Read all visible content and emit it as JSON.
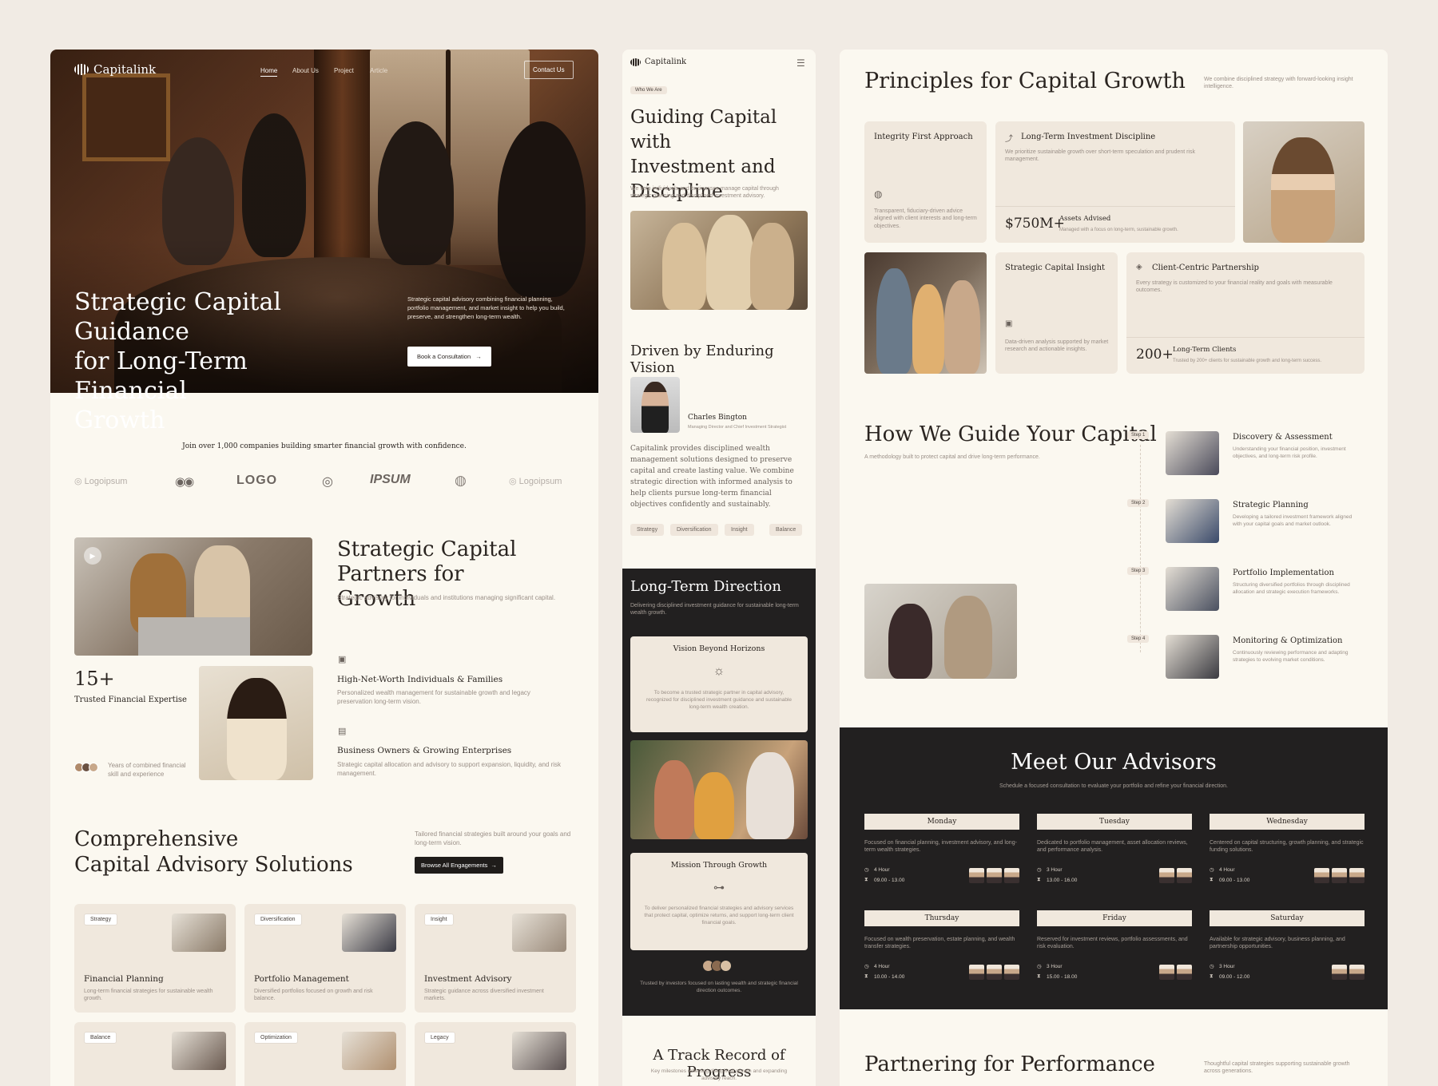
{
  "card1": {
    "nav": {
      "brand": "Capitalink",
      "links": [
        "Home",
        "About Us",
        "Project",
        "Article"
      ],
      "cta": "Contact Us"
    },
    "hero": {
      "title_l1": "Strategic Capital Guidance",
      "title_l2": "for Long-Term Financial",
      "title_l3": "Growth",
      "desc": "Strategic capital advisory combining financial planning, portfolio management, and market insight to help you build, preserve, and strengthen long-term wealth.",
      "button": "Book a Consultation"
    },
    "logos": {
      "intro": "Join over 1,000 companies building smarter financial growth with confidence.",
      "items": [
        "Logoipsum",
        "LOGO",
        "IPSUM",
        "Logoipsum"
      ]
    },
    "partners": {
      "title_l1": "Strategic Capital Partners for",
      "title_l2": "Growth",
      "subtitle": "Strategic advisory for individuals and institutions managing significant capital.",
      "stat_value": "15+",
      "stat_label": "Trusted Financial Expertise",
      "stat_note": "Years of combined financial skill and experience",
      "item1_title": "High-Net-Worth Individuals & Families",
      "item1_desc": "Personalized wealth management for sustainable growth and legacy preservation long-term vision.",
      "item2_title": "Business Owners & Growing Enterprises",
      "item2_desc": "Strategic capital allocation and advisory to support expansion, liquidity, and risk management."
    },
    "solutions": {
      "title_l1": "Comprehensive",
      "title_l2": "Capital Advisory Solutions",
      "desc": "Tailored financial strategies built around your goals and long-term vision.",
      "button": "Browse All Engagements",
      "cards": [
        {
          "tag": "Strategy",
          "title": "Financial Planning",
          "desc": "Long-term financial strategies for sustainable wealth growth."
        },
        {
          "tag": "Diversification",
          "title": "Portfolio Management",
          "desc": "Diversified portfolios focused on growth and risk balance."
        },
        {
          "tag": "Insight",
          "title": "Investment Advisory",
          "desc": "Strategic guidance across diversified investment markets."
        },
        {
          "tag": "Balance",
          "title": "",
          "desc": ""
        },
        {
          "tag": "Optimization",
          "title": "",
          "desc": ""
        },
        {
          "tag": "Legacy",
          "title": "",
          "desc": ""
        }
      ]
    }
  },
  "card2": {
    "brand": "Capitalink",
    "who_tag": "Who We Are",
    "title_l1": "Guiding Capital with",
    "title_l2": "Investment and",
    "title_l3": "Discipline",
    "desc": "We help individuals and businesses manage capital through strategic planning and disciplined investment advisory.",
    "vision_title": "Driven by Enduring Vision",
    "person_name": "Charles Bington",
    "person_role": "Managing Director and Chief Investment Strategist",
    "quote": "Capitalink provides disciplined wealth management solutions designed to preserve capital and create lasting value. We combine strategic direction with informed analysis to help clients pursue long-term financial objectives confidently and sustainably.",
    "pills": [
      "Strategy",
      "Diversification",
      "Insight",
      "Balance"
    ],
    "direction_title": "Long-Term Direction",
    "direction_desc": "Delivering disciplined investment guidance for sustainable long-term wealth growth.",
    "vision_box_title": "Vision Beyond Horizons",
    "vision_box_desc": "To become a trusted strategic partner in capital advisory, recognized for disciplined investment guidance and sustainable long-term wealth creation.",
    "mission_box_title": "Mission Through Growth",
    "mission_box_desc": "To deliver personalized financial strategies and advisory services that protect capital, optimize returns, and support long-term client financial goals.",
    "trusted": "Trusted by investors focused on lasting wealth and strategic financial direction outcomes.",
    "track_title": "A Track Record of Progress",
    "track_desc": "Key milestones reflecting disciplined growth and expanding advisory reach."
  },
  "card3": {
    "principles_title": "Principles for Capital Growth",
    "principles_desc": "We combine disciplined strategy with forward-looking insight intelligence.",
    "integrity_title": "Integrity First Approach",
    "integrity_desc": "Transparent, fiduciary-driven advice aligned with client interests and long-term objectives.",
    "discipline_title": "Long-Term Investment Discipline",
    "discipline_desc": "We prioritize sustainable growth over short-term speculation and prudent risk management.",
    "assets_value": "$750M+",
    "assets_label": "Assets Advised",
    "assets_note": "Managed with a focus on long-term, sustainable growth.",
    "insight_title": "Strategic Capital Insight",
    "insight_desc": "Data-driven analysis supported by market research and actionable insights.",
    "client_title": "Client-Centric Partnership",
    "client_desc": "Every strategy is customized to your financial reality and goals with measurable outcomes.",
    "clients_value": "200+",
    "clients_label": "Long-Term Clients",
    "clients_note": "Trusted by 200+ clients for sustainable growth and long-term success.",
    "guide_title": "How We Guide Your Capital",
    "guide_desc": "A methodology built to protect capital and drive long-term performance.",
    "steps": [
      {
        "step": "Step 1",
        "title": "Discovery & Assessment",
        "desc": "Understanding your financial position, investment objectives, and long-term risk profile."
      },
      {
        "step": "Step 2",
        "title": "Strategic Planning",
        "desc": "Developing a tailored investment framework aligned with your capital goals and market outlook."
      },
      {
        "step": "Step 3",
        "title": "Portfolio Implementation",
        "desc": "Structuring diversified portfolios through disciplined allocation and strategic execution frameworks."
      },
      {
        "step": "Step 4",
        "title": "Monitoring & Optimization",
        "desc": "Continuously reviewing performance and adapting strategies to evolving market conditions."
      }
    ],
    "advisors_title": "Meet Our Advisors",
    "advisors_desc": "Schedule a focused consultation to evaluate your portfolio and refine your financial direction.",
    "days": [
      {
        "day": "Monday",
        "desc": "Focused on financial planning, investment advisory, and long-term wealth strategies.",
        "hours": "4 Hour",
        "time": "09.00 - 13.00"
      },
      {
        "day": "Tuesday",
        "desc": "Dedicated to portfolio management, asset allocation reviews, and performance analysis.",
        "hours": "3 Hour",
        "time": "13.00 - 16.00"
      },
      {
        "day": "Wednesday",
        "desc": "Centered on capital structuring, growth planning, and strategic funding solutions.",
        "hours": "4 Hour",
        "time": "09.00 - 13.00"
      },
      {
        "day": "Thursday",
        "desc": "Focused on wealth preservation, estate planning, and wealth transfer strategies.",
        "hours": "4 Hour",
        "time": "10.00 - 14.00"
      },
      {
        "day": "Friday",
        "desc": "Reserved for investment reviews, portfolio assessments, and risk evaluation.",
        "hours": "3 Hour",
        "time": "15.00 - 18.00"
      },
      {
        "day": "Saturday",
        "desc": "Available for strategic advisory, business planning, and partnership opportunities.",
        "hours": "3 Hour",
        "time": "09.00 - 12.00"
      }
    ],
    "perf_title": "Partnering for Performance",
    "perf_desc": "Thoughtful capital strategies supporting sustainable growth across generations."
  }
}
